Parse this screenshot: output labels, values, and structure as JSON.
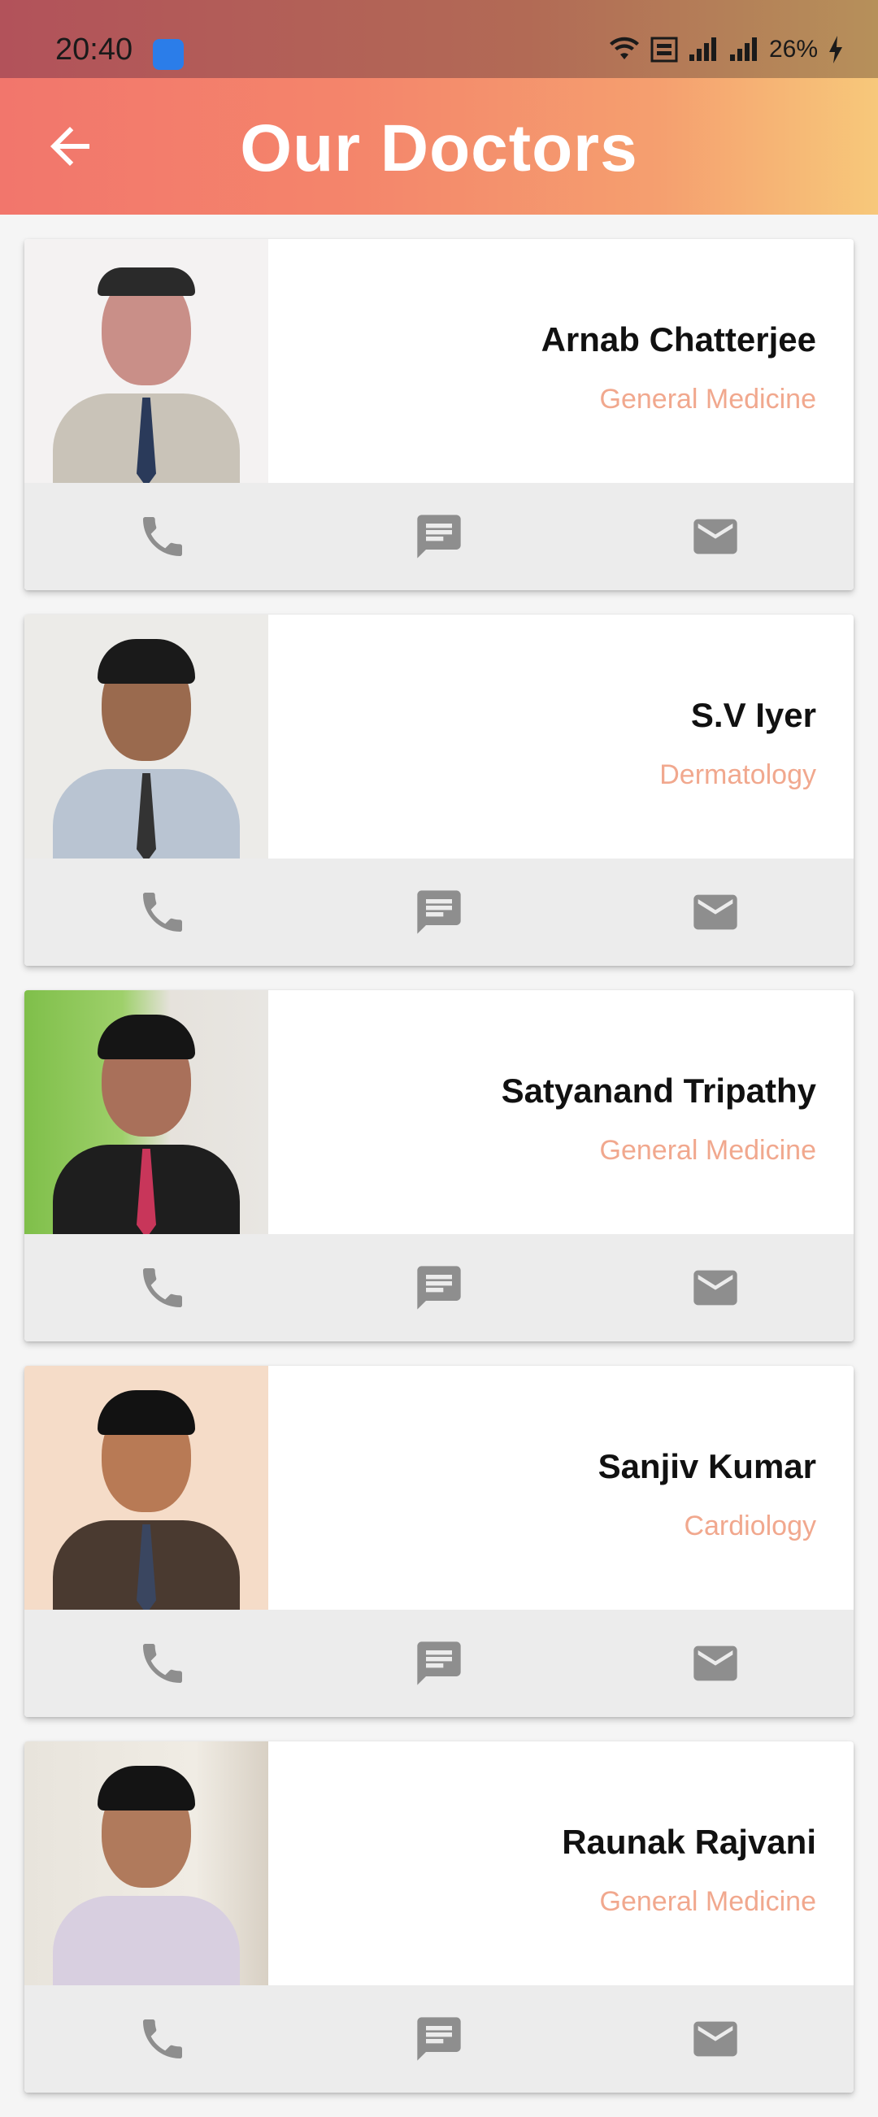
{
  "status_bar": {
    "time": "20:40",
    "battery": "26%",
    "icons": [
      "usb-icon",
      "wifi-icon",
      "volte-icon",
      "signal-icon",
      "signal-icon",
      "charging-icon"
    ]
  },
  "app_bar": {
    "title": "Our Doctors",
    "back_icon": "arrow-back-icon"
  },
  "doctors": [
    {
      "name": "Arnab Chatterjee",
      "specialty": "General Medicine"
    },
    {
      "name": "S.V Iyer",
      "specialty": "Dermatology"
    },
    {
      "name": "Satyanand Tripathy",
      "specialty": "General Medicine"
    },
    {
      "name": "Sanjiv Kumar",
      "specialty": "Cardiology"
    },
    {
      "name": "Raunak Rajvani",
      "specialty": "General Medicine"
    }
  ],
  "action_icons": [
    "phone-icon",
    "message-icon",
    "mail-icon"
  ],
  "colors": {
    "appbar_start": "#f2766c",
    "appbar_end": "#f7c87a",
    "specialty": "#f1a88e",
    "action_bg": "#ececec",
    "action_icon": "#8e8e8e"
  }
}
